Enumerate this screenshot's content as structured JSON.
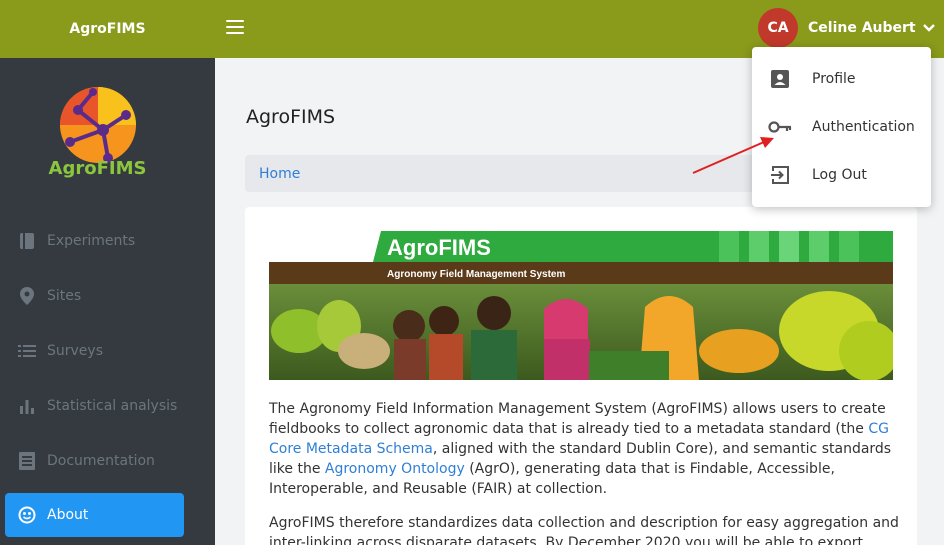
{
  "header": {
    "brand": "AgroFIMS",
    "user_initials": "CA",
    "user_name": "Celine Aubert"
  },
  "sidebar": {
    "logo_text": "AgroFIMS",
    "items": [
      {
        "label": "Experiments",
        "icon": "book-icon"
      },
      {
        "label": "Sites",
        "icon": "map-pin-icon"
      },
      {
        "label": "Surveys",
        "icon": "list-icon"
      },
      {
        "label": "Statistical analysis",
        "icon": "bar-chart-icon"
      },
      {
        "label": "Documentation",
        "icon": "document-icon"
      },
      {
        "label": "About",
        "icon": "about-icon",
        "active": true
      }
    ]
  },
  "main": {
    "title": "AgroFIMS",
    "breadcrumb": "Home",
    "banner": {
      "title": "AgroFIMS",
      "subtitle": "Agronomy Field Management System"
    },
    "paragraph1": {
      "t1": "The Agronomy Field Information Management System (AgroFIMS) allows users to create fieldbooks to collect agronomic data that is already tied to a metadata standard (the ",
      "link1": "CG Core Metadata Schema",
      "t2": ", aligned with the standard Dublin Core), and semantic standards like the ",
      "link2": "Agronomy Ontology",
      "t3": " (AgrO), generating data that is Findable, Accessible, Interoperable, and Reusable (FAIR) at collection."
    },
    "paragraph2": "AgroFIMS therefore standardizes data collection and description for easy aggregation and inter-linking across disparate datasets. By December 2020 you will be able to export"
  },
  "user_menu": {
    "items": [
      {
        "label": "Profile",
        "icon": "profile-card-icon"
      },
      {
        "label": "Authentication",
        "icon": "key-icon"
      },
      {
        "label": "Log Out",
        "icon": "logout-icon"
      }
    ]
  },
  "colors": {
    "topbar": "#8a9a1b",
    "sidebar": "#343a40",
    "active": "#2196f3",
    "avatar": "#c0392b",
    "annotation_arrow": "#e02020"
  }
}
